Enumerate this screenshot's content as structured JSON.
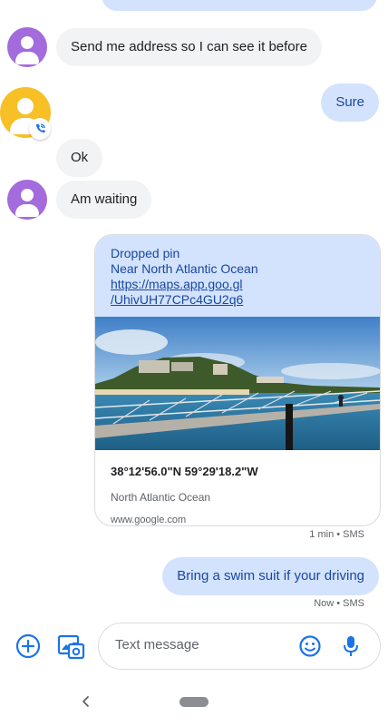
{
  "messages": {
    "m1": "Send me address so I can see it before",
    "m2": "Sure",
    "m3": "Ok",
    "m4": "Am waiting",
    "m5": "Bring a swim suit if your driving"
  },
  "location_card": {
    "title": "Dropped pin",
    "subtitle": "Near North Atlantic Ocean",
    "link_line1": "https://maps.app.goo.gl",
    "link_line2": "/UhivUH77CPc4GU2q6",
    "coords": "38°12'56.0\"N 59°29'18.2\"W",
    "place": "North Atlantic Ocean",
    "domain": "www.google.com"
  },
  "timestamps": {
    "card": "1 min • SMS",
    "last": "Now • SMS"
  },
  "compose": {
    "placeholder": "Text message"
  },
  "colors": {
    "avatar_purple": "#a36bdc",
    "avatar_yellow": "#f6c026",
    "outgoing_bubble": "#d3e3fd",
    "incoming_bubble": "#f1f3f4",
    "accent_blue": "#1a73e8"
  },
  "icons": {
    "add": "plus-circle-icon",
    "gallery": "gallery-icon",
    "emoji": "emoji-icon",
    "mic": "mic-icon",
    "call_badge": "phone-call-icon",
    "back": "back-chevron-icon",
    "home": "home-pill"
  }
}
